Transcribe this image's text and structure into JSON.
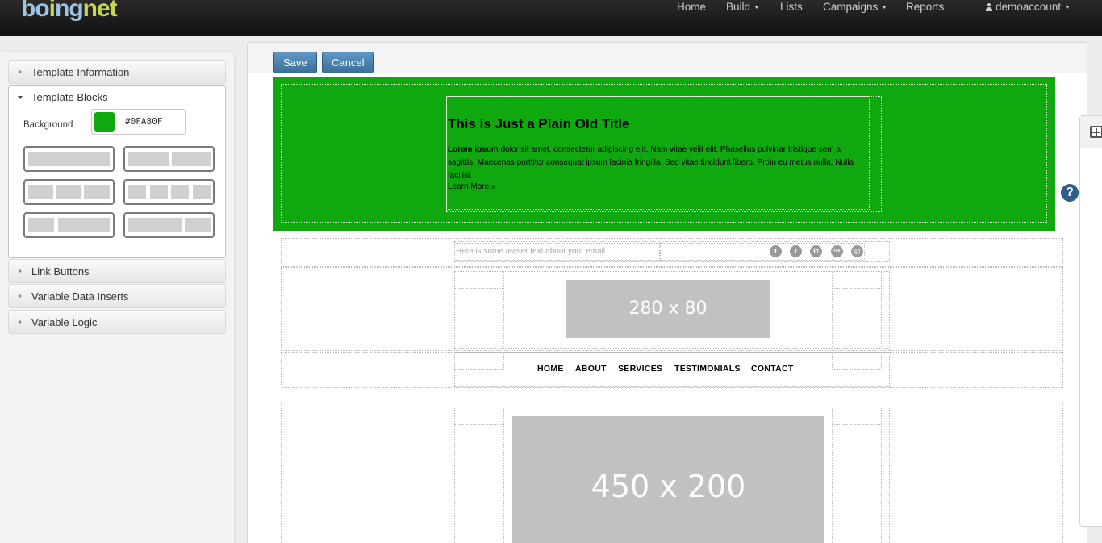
{
  "brand": {
    "logo_part1": "bo",
    "logo_part2": "i",
    "logo_part3": "ng",
    "logo_part4": "net"
  },
  "nav": {
    "home": "Home",
    "build": "Build",
    "lists": "Lists",
    "campaigns": "Campaigns",
    "reports": "Reports",
    "account": "demoaccount"
  },
  "sidebar": {
    "template_information": "Template Information",
    "template_blocks": "Template Blocks",
    "background_label": "Background",
    "background_color": "#0FA80F",
    "link_buttons": "Link Buttons",
    "variable_data_inserts": "Variable Data Inserts",
    "variable_logic": "Variable Logic"
  },
  "toolbar": {
    "save": "Save",
    "cancel": "Cancel"
  },
  "hero": {
    "title": "This is Just a Plain Old Title",
    "body_bold": "Lorem ipsum",
    "body": " dolor sit amet, consectetur adipiscing elit. Nam vitae velit elit. Phasellus pulvinar tristique sem a sagittis. Maecenas porttitor consequat ipsum lacinia fringilla. Sed vitae tincidunt libero. Proin eu metus nulla. Nulla facilisi.",
    "learn_more": "Learn More »",
    "bg_color": "#0FA80F"
  },
  "teaser": "Here is some teaser text about your email",
  "social": [
    "f",
    "t",
    "in",
    "rss",
    "@"
  ],
  "header_image": "280 x 80",
  "menu": [
    "HOME",
    "ABOUT",
    "SERVICES",
    "TESTIMONIALS",
    "CONTACT"
  ],
  "main_image": "450 x 200",
  "help": "?"
}
